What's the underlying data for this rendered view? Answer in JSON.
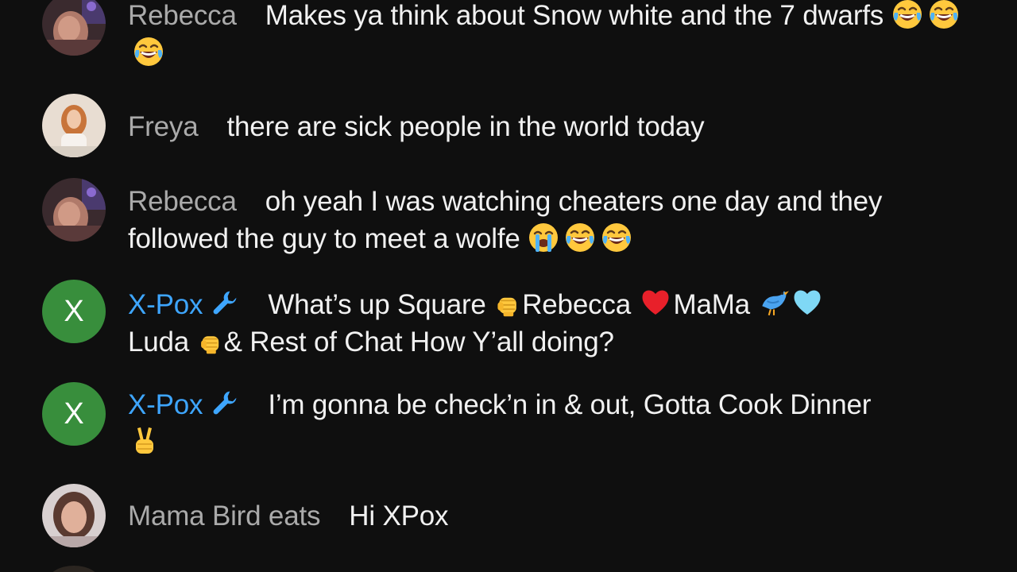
{
  "messages": [
    {
      "author": "Rebecca",
      "avatar_type": "photo",
      "text": "Makes ya think about Snow white and the 7 dwarfs",
      "emojis": [
        "face-with-tears-of-joy",
        "face-with-tears-of-joy",
        "face-with-tears-of-joy"
      ]
    },
    {
      "author": "Freya",
      "avatar_type": "photo",
      "text": "there are sick people in the world today"
    },
    {
      "author": "Rebecca",
      "avatar_type": "photo",
      "text": "oh yeah I was watching cheaters one day and they followed the guy to meet a wolfe",
      "emojis": [
        "loudly-crying-face",
        "face-with-tears-of-joy",
        "face-with-tears-of-joy"
      ]
    },
    {
      "author": "X-Pox",
      "avatar_type": "letter",
      "avatar_letter": "X",
      "avatar_color": "#388e3c",
      "author_color": "#3ea6ff",
      "badge": "wrench-icon",
      "segments": [
        "What’s up Square",
        "Rebecca",
        "MaMa",
        "Luda",
        "& Rest of Chat How Y’all doing?"
      ]
    },
    {
      "author": "X-Pox",
      "avatar_type": "letter",
      "avatar_letter": "X",
      "avatar_color": "#388e3c",
      "author_color": "#3ea6ff",
      "badge": "wrench-icon",
      "text": "I’m gonna be check’n in & out, Gotta Cook Dinner",
      "emojis": [
        "victory-hand"
      ]
    },
    {
      "author": "Mama Bird eats",
      "avatar_type": "photo",
      "text": "Hi XPox"
    }
  ],
  "colors": {
    "background": "#0f0f0f",
    "author_default": "#aaaaaa",
    "author_member": "#3ea6ff",
    "message_text": "#f1f1f1"
  }
}
